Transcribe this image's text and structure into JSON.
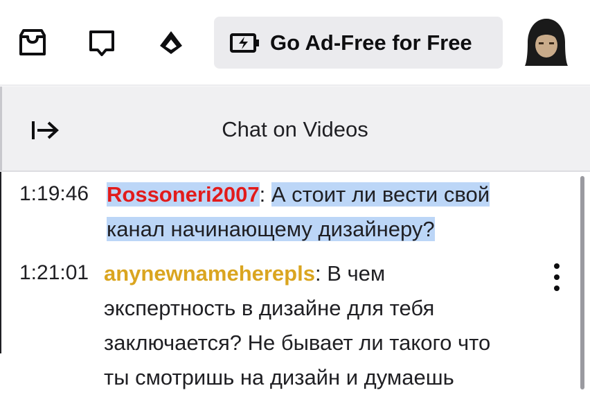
{
  "topbar": {
    "inbox_icon": "inbox-icon",
    "whispers_icon": "whispers-icon",
    "prime_icon": "prime-crown-icon",
    "adfree_button": {
      "icon": "battery-bolt-icon",
      "label": "Go Ad-Free for Free"
    },
    "avatar": "user-avatar"
  },
  "chat_header": {
    "collapse_icon": "collapse-arrow-icon",
    "title": "Chat on Videos"
  },
  "messages": [
    {
      "timestamp": "1:19:46",
      "author": "Rossoneri2007",
      "author_color": "#e21b1b",
      "separator": ":",
      "text_line1": "А стоит ли вести свой",
      "text_line2": "канал начинающему дизайнеру?"
    },
    {
      "timestamp": "1:21:01",
      "author": "anynewnameherepls",
      "author_color": "#daa520",
      "separator": ":",
      "text_line1": "В чем",
      "text_line2": "экспертность в дизайне для тебя",
      "text_line3": "заключается? Не бывает ли такого что",
      "text_line4": "ты смотришь на дизайн и думаешь"
    }
  ],
  "colors": {
    "selection": "#bcd6f7",
    "header_bg": "#f0f0f2",
    "button_bg": "#ebebee"
  }
}
